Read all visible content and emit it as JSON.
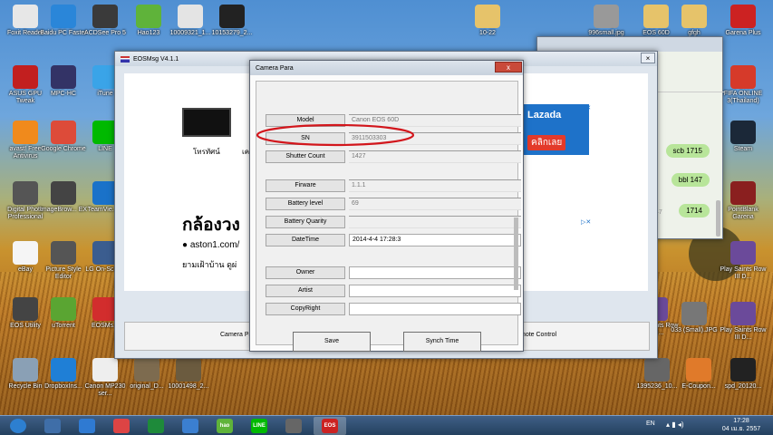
{
  "desktop_icons": [
    {
      "label": "Foxit Reader",
      "icon": "foxit-icon",
      "color": "#e7e7e7"
    },
    {
      "label": "Baidu PC Faster",
      "icon": "baidu-icon",
      "color": "#2a86d9"
    },
    {
      "label": "ACDSee Pro 5",
      "icon": "camera-icon",
      "color": "#3a3a3a"
    },
    {
      "label": "Hao123",
      "icon": "hao123-icon",
      "color": "#5fb33a"
    },
    {
      "label": "10009321_1...",
      "icon": "envelope-icon",
      "color": "#e4e4e4"
    },
    {
      "label": "10153279_2...",
      "icon": "file-icon",
      "color": "#222222"
    },
    {
      "label": "ASUS GPU Tweak",
      "icon": "gpu-icon",
      "color": "#c21f1f"
    },
    {
      "label": "MPC-HC",
      "icon": "mpc-icon",
      "color": "#333366"
    },
    {
      "label": "iTune",
      "icon": "itunes-icon",
      "color": "#3aa4e8"
    },
    {
      "label": "avast! Free Antivirus",
      "icon": "avast-icon",
      "color": "#f08a1c"
    },
    {
      "label": "Google Chrome",
      "icon": "chrome-icon",
      "color": "#dd4b39"
    },
    {
      "label": "LINE",
      "icon": "line-icon",
      "color": "#00b900"
    },
    {
      "label": "Digital Photo Professional",
      "icon": "dpp-icon",
      "color": "#555555"
    },
    {
      "label": "ImageBrow... EX",
      "icon": "camera-icon",
      "color": "#444444"
    },
    {
      "label": "TeamVie... 9",
      "icon": "teamviewer-icon",
      "color": "#1a72c9"
    },
    {
      "label": "eBay",
      "icon": "ebay-icon",
      "color": "#f5f5f5"
    },
    {
      "label": "Picture Style Editor",
      "icon": "picture-style-icon",
      "color": "#555555"
    },
    {
      "label": "LG On-Scre...",
      "icon": "lg-icon",
      "color": "#3b5d8f"
    },
    {
      "label": "EOS Utility",
      "icon": "eos-utility-icon",
      "color": "#444444"
    },
    {
      "label": "uTorrent",
      "icon": "utorrent-icon",
      "color": "#5aa532"
    },
    {
      "label": "EOSMs...",
      "icon": "eosmsg-icon",
      "color": "#d22d2d"
    },
    {
      "label": "Recycle Bin",
      "icon": "recycle-bin-icon",
      "color": "#8aa0b5"
    },
    {
      "label": "DropboxIns...",
      "icon": "dropbox-icon",
      "color": "#1f7fd6"
    },
    {
      "label": "Canon MP230 ser...",
      "icon": "printer-icon",
      "color": "#eeeeee"
    },
    {
      "label": "original_D...",
      "icon": "image-icon",
      "color": "#7d6b4f"
    },
    {
      "label": "10001498_2...",
      "icon": "image-icon",
      "color": "#6b5b3f"
    },
    {
      "label": "10-22",
      "icon": "folder-icon",
      "color": "#e6c36a"
    },
    {
      "label": "996small.jpg",
      "icon": "image-icon",
      "color": "#999999"
    },
    {
      "label": "EOS 60D",
      "icon": "folder-icon",
      "color": "#e6c36a"
    },
    {
      "label": "gfgh",
      "icon": "folder-icon",
      "color": "#e6c36a"
    },
    {
      "label": "Garena Plus",
      "icon": "garena-icon",
      "color": "#cc2222"
    },
    {
      "label": "FIFA ONLINE 3(Thailand)",
      "icon": "fifa-icon",
      "color": "#d63a2a"
    },
    {
      "label": "Steam",
      "icon": "steam-icon",
      "color": "#1b2838"
    },
    {
      "label": "PointBlank Garena",
      "icon": "pointblank-icon",
      "color": "#8a1f1f"
    },
    {
      "label": "Play Saints Row III D...",
      "icon": "saints-row-icon",
      "color": "#6b4a9a"
    },
    {
      "label": "Play Saints Row III D...",
      "icon": "saints-row-icon",
      "color": "#6b4a9a"
    },
    {
      "label": "033 (Small).JPG",
      "icon": "image-icon",
      "color": "#777777"
    },
    {
      "label": "Play Saints Row III D...",
      "icon": "saints-row-icon",
      "color": "#6b4a9a"
    },
    {
      "label": "1395236_10...",
      "icon": "image-icon",
      "color": "#666666"
    },
    {
      "label": "E-Coupon...",
      "icon": "coupon-icon",
      "color": "#e07a2a"
    },
    {
      "label": "spd_20120...",
      "icon": "file-icon",
      "color": "#222222"
    }
  ],
  "eosmsg": {
    "title": "EOSMsg V4.1.1",
    "ad_labels": [
      "โทรทัศน์",
      "เค"
    ],
    "ad_heading": "กล้องวง",
    "ad_url": "aston1.com/",
    "ad_text": "ยามเฝ้าบ้าน  ดูผ่",
    "lazada_brand": "Lazada",
    "lazada_button": "คลิกเลย",
    "tab_camera": "Camera Pa",
    "tab_remote": "mote Control"
  },
  "chat": {
    "messages": [
      {
        "text": "scb  1715"
      },
      {
        "text": "bbl  147"
      },
      {
        "text": "1714"
      }
    ],
    "small_number": "47"
  },
  "dialog": {
    "title": "Camera Para",
    "close_label": "x",
    "fields": [
      {
        "label": "Model",
        "value": "Canon EOS 60D"
      },
      {
        "label": "SN",
        "value": "3911503303"
      },
      {
        "label": "Shutter Count",
        "value": "1427"
      },
      {
        "label": "Firware",
        "value": "1.1.1"
      },
      {
        "label": "Battery level",
        "value": "69"
      },
      {
        "label": "Battery Quarity",
        "value": ""
      },
      {
        "label": "DateTime",
        "value": "2014-4-4 17:28:3"
      },
      {
        "label": "Owner",
        "value": ""
      },
      {
        "label": "Artist",
        "value": ""
      },
      {
        "label": "CopyRight",
        "value": ""
      }
    ],
    "save_label": "Save",
    "synch_label": "Synch Time",
    "highlight_color": "#d2161c"
  },
  "taskbar": {
    "apps": [
      {
        "icon": "start-orb-icon",
        "label": ""
      },
      {
        "icon": "explorer-icon",
        "label": ""
      },
      {
        "icon": "ie-icon",
        "label": ""
      },
      {
        "icon": "chrome-icon",
        "label": ""
      },
      {
        "icon": "excel-icon",
        "label": ""
      },
      {
        "icon": "notepad-icon",
        "label": ""
      },
      {
        "icon": "hao123-icon",
        "label": "hao"
      },
      {
        "icon": "line-icon",
        "label": "LINE"
      },
      {
        "icon": "camera-icon",
        "label": ""
      },
      {
        "icon": "eosmsg-icon",
        "label": "EOS"
      }
    ],
    "language": "EN",
    "time": "17:28",
    "date": "04 เม.ย. 2557"
  }
}
